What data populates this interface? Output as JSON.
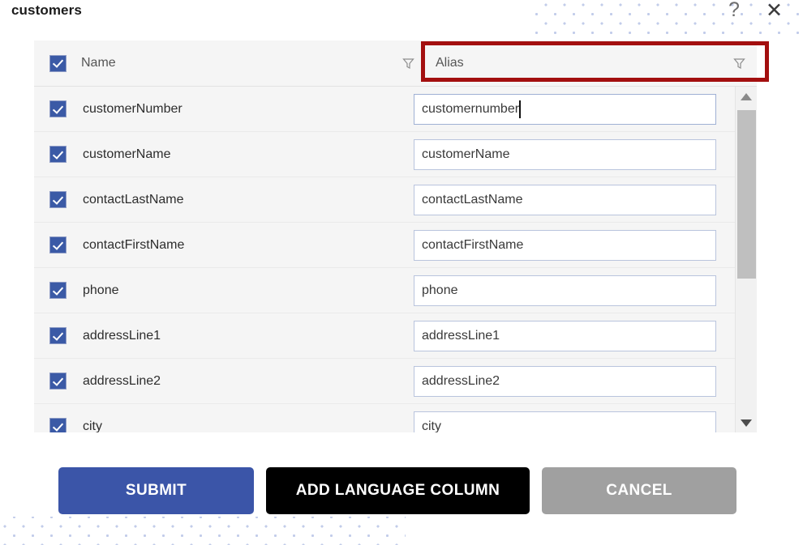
{
  "window": {
    "title": "customers",
    "help_icon": "question-mark-icon",
    "close_icon": "close-x-icon",
    "help_glyph": "?",
    "close_glyph": "✕"
  },
  "table": {
    "headers": {
      "select_all_checked": true,
      "name": "Name",
      "alias": "Alias",
      "name_filter_icon": "filter-funnel-icon",
      "alias_filter_icon": "filter-funnel-icon"
    },
    "highlight": {
      "target": "alias-column-header",
      "color": "#a30f0f"
    },
    "rows": [
      {
        "checked": true,
        "name": "customerNumber",
        "alias": "customernumber",
        "focused": true
      },
      {
        "checked": true,
        "name": "customerName",
        "alias": "customerName",
        "focused": false
      },
      {
        "checked": true,
        "name": "contactLastName",
        "alias": "contactLastName",
        "focused": false
      },
      {
        "checked": true,
        "name": "contactFirstName",
        "alias": "contactFirstName",
        "focused": false
      },
      {
        "checked": true,
        "name": "phone",
        "alias": "phone",
        "focused": false
      },
      {
        "checked": true,
        "name": "addressLine1",
        "alias": "addressLine1",
        "focused": false
      },
      {
        "checked": true,
        "name": "addressLine2",
        "alias": "addressLine2",
        "focused": false
      },
      {
        "checked": true,
        "name": "city",
        "alias": "city",
        "focused": false
      }
    ],
    "scrollbar": {
      "up_arrow_icon": "scroll-up-arrow-icon",
      "down_arrow_icon": "scroll-down-arrow-icon",
      "thumb_position_percent": 0,
      "thumb_size_percent": 55
    }
  },
  "buttons": {
    "submit": "SUBMIT",
    "add_language_column": "ADD LANGUAGE COLUMN",
    "cancel": "CANCEL"
  },
  "colors": {
    "primary_blue": "#3b55a8",
    "checkbox_blue": "#3b5aa6",
    "black_button": "#000000",
    "cancel_gray": "#a0a0a0",
    "highlight_red": "#a30f0f",
    "row_background": "#f5f5f5",
    "dot_pattern": "#c2ccea"
  }
}
